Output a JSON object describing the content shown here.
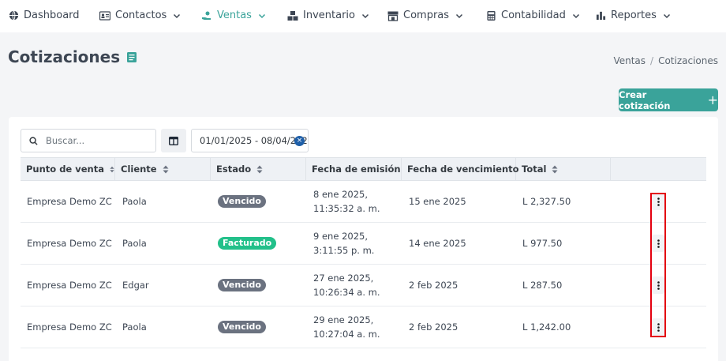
{
  "nav": {
    "items": [
      {
        "label": "Dashboard",
        "icon": "globe-icon",
        "dropdown": false,
        "active": false
      },
      {
        "label": "Contactos",
        "icon": "contact-card-icon",
        "dropdown": true,
        "active": false
      },
      {
        "label": "Ventas",
        "icon": "hand-coin-icon",
        "dropdown": true,
        "active": true
      },
      {
        "label": "Inventario",
        "icon": "boxes-icon",
        "dropdown": true,
        "active": false
      },
      {
        "label": "Compras",
        "icon": "store-icon",
        "dropdown": true,
        "active": false
      },
      {
        "label": "Contabilidad",
        "icon": "calculator-icon",
        "dropdown": true,
        "active": false
      },
      {
        "label": "Reportes",
        "icon": "bar-chart-icon",
        "dropdown": true,
        "active": false
      }
    ],
    "active_color": "#3aa39a"
  },
  "header": {
    "title": "Cotizaciones",
    "breadcrumb": [
      "Ventas",
      "Cotizaciones"
    ],
    "create_label": "Crear cotización"
  },
  "filters": {
    "search_placeholder": "Buscar...",
    "date_range": "01/01/2025  - 08/04/2025"
  },
  "table": {
    "columns": [
      "Punto de venta",
      "Cliente",
      "Estado",
      "Fecha de emisión",
      "Fecha de vencimiento",
      "Total"
    ],
    "rows": [
      {
        "pos": "Empresa Demo ZC",
        "client": "Paola",
        "status": "Vencido",
        "status_color": "#6b7280",
        "issued": "8 ene 2025, 11:35:32 a. m.",
        "due": "15 ene 2025",
        "total": "L 2,327.50"
      },
      {
        "pos": "Empresa Demo ZC",
        "client": "Paola",
        "status": "Facturado",
        "status_color": "#22c08a",
        "issued": "9 ene 2025, 3:11:55 p. m.",
        "due": "14 ene 2025",
        "total": "L 977.50"
      },
      {
        "pos": "Empresa Demo ZC",
        "client": "Edgar",
        "status": "Vencido",
        "status_color": "#6b7280",
        "issued": "27 ene 2025, 10:26:34 a. m.",
        "due": "2 feb 2025",
        "total": "L 287.50"
      },
      {
        "pos": "Empresa Demo ZC",
        "client": "Paola",
        "status": "Vencido",
        "status_color": "#6b7280",
        "issued": "29 ene 2025, 10:27:04 a. m.",
        "due": "2 feb 2025",
        "total": "L 1,242.00"
      }
    ]
  },
  "colors": {
    "accent": "#3aa39a",
    "highlight": "#e3000f"
  }
}
